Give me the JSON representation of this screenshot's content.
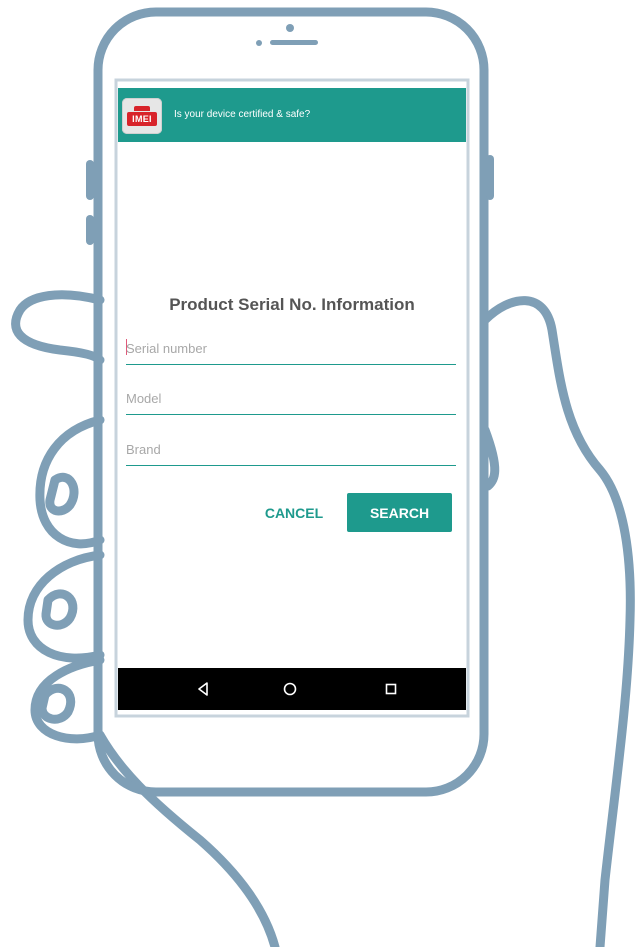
{
  "app": {
    "header_title": "Is your device certified & safe?",
    "logo_icon": "app-logo-icon",
    "accent_color": "#1e9a8d"
  },
  "form": {
    "title": "Product Serial No. Information",
    "serial": {
      "placeholder": "Serial number",
      "value": ""
    },
    "model": {
      "placeholder": "Model",
      "value": ""
    },
    "brand": {
      "placeholder": "Brand",
      "value": ""
    },
    "cancel_label": "CANCEL",
    "search_label": "SEARCH"
  },
  "navbar": {
    "back_icon": "back-triangle-icon",
    "home_icon": "home-circle-icon",
    "recent_icon": "recent-apps-square-icon"
  }
}
